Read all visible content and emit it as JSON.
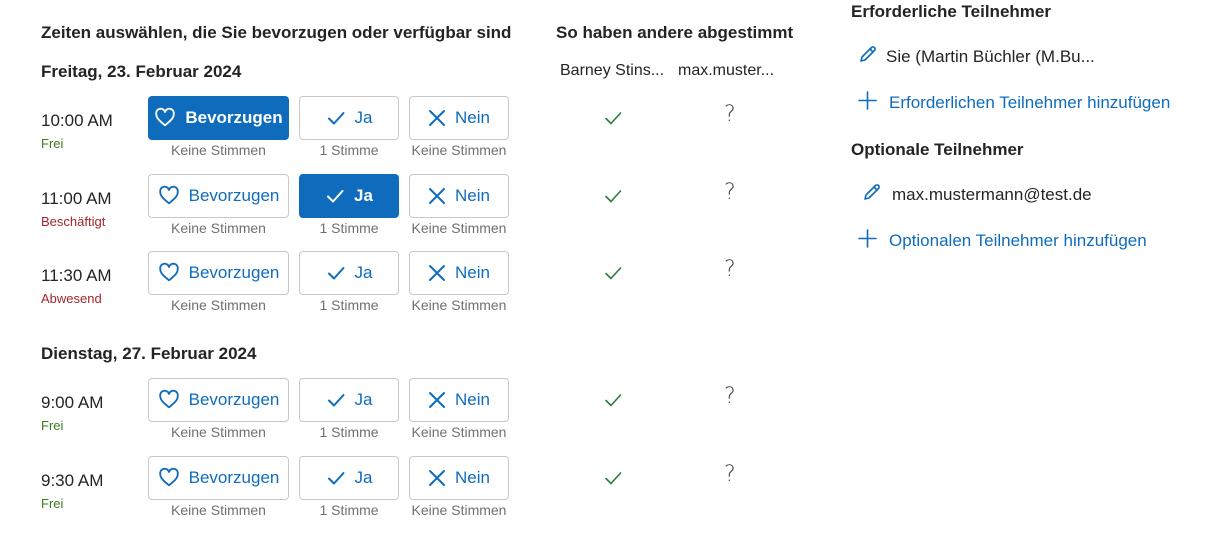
{
  "left": {
    "title": "Zeiten auswählen, die Sie bevorzugen oder verfügbar sind",
    "others_title": "So haben andere abgestimmt",
    "attendee_columns": [
      "Barney Stins...",
      "max.muster..."
    ],
    "buttons": {
      "prefer": "Bevorzugen",
      "yes": "Ja",
      "no": "Nein"
    },
    "days": [
      {
        "date": "Freitag, 23. Februar 2024",
        "slots": [
          {
            "time": "10:00 AM",
            "status": "Frei",
            "status_color": "#3a7d1f",
            "selected": "prefer",
            "votes": {
              "prefer": "Keine Stimmen",
              "yes": "1 Stimme",
              "no": "Keine Stimmen"
            },
            "responses": [
              "yes",
              "unknown"
            ]
          },
          {
            "time": "11:00 AM",
            "status": "Beschäftigt",
            "status_color": "#a4262c",
            "selected": "yes",
            "votes": {
              "prefer": "Keine Stimmen",
              "yes": "1 Stimme",
              "no": "Keine Stimmen"
            },
            "responses": [
              "yes",
              "unknown"
            ]
          },
          {
            "time": "11:30 AM",
            "status": "Abwesend",
            "status_color": "#a4262c",
            "selected": "",
            "votes": {
              "prefer": "Keine Stimmen",
              "yes": "1 Stimme",
              "no": "Keine Stimmen"
            },
            "responses": [
              "yes",
              "unknown"
            ]
          }
        ]
      },
      {
        "date": "Dienstag, 27. Februar 2024",
        "slots": [
          {
            "time": "9:00 AM",
            "status": "Frei",
            "status_color": "#3a7d1f",
            "selected": "",
            "votes": {
              "prefer": "Keine Stimmen",
              "yes": "1 Stimme",
              "no": "Keine Stimmen"
            },
            "responses": [
              "yes",
              "unknown"
            ]
          },
          {
            "time": "9:30 AM",
            "status": "Frei",
            "status_color": "#3a7d1f",
            "selected": "",
            "votes": {
              "prefer": "Keine Stimmen",
              "yes": "1 Stimme",
              "no": "Keine Stimmen"
            },
            "responses": [
              "yes",
              "unknown"
            ]
          }
        ]
      }
    ],
    "unknown_glyph": "?"
  },
  "right": {
    "required_title": "Erforderliche Teilnehmer",
    "required_person": "Sie (Martin Büchler (M.Bu...",
    "add_required": "Erforderlichen Teilnehmer hinzufügen",
    "optional_title": "Optionale Teilnehmer",
    "optional_person": "max.mustermann@test.de",
    "add_optional": "Optionalen Teilnehmer hinzufügen"
  },
  "colors": {
    "accent": "#0f6cbd",
    "check": "#2d7d3a",
    "free": "#3a7d1f",
    "busy": "#a4262c"
  }
}
